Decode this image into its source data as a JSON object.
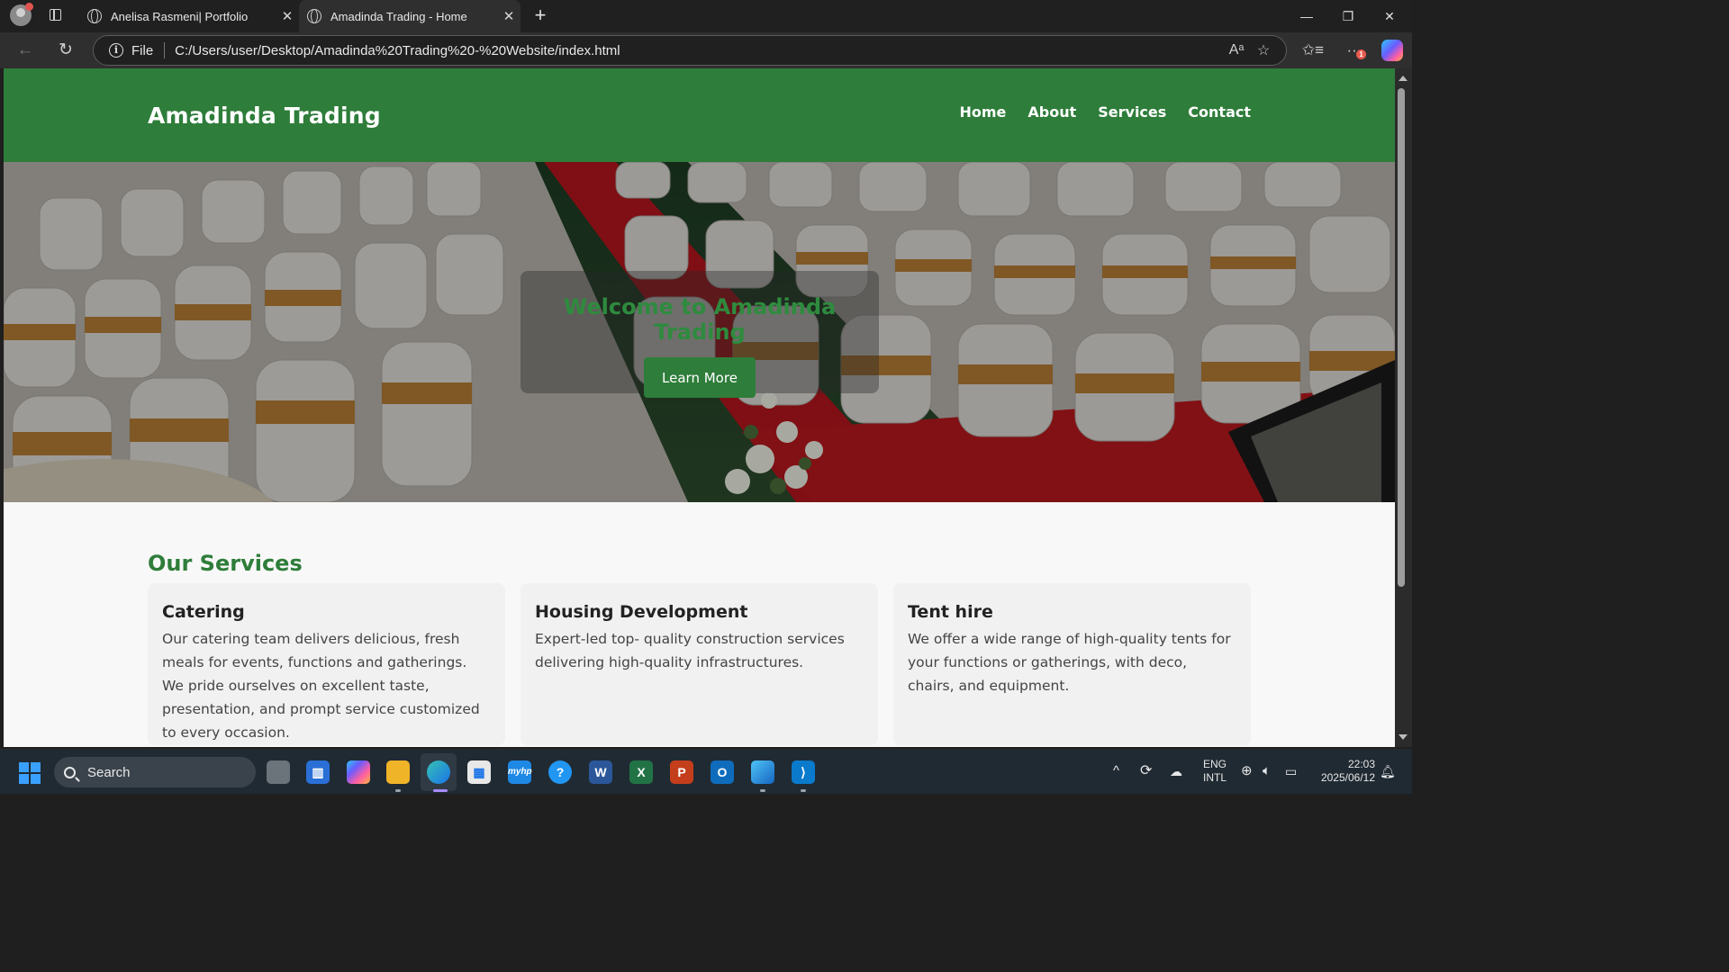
{
  "browser": {
    "tabs": [
      {
        "title": "Anelisa Rasmeni| Portfolio",
        "active": false
      },
      {
        "title": "Amadinda Trading - Home",
        "active": true
      }
    ],
    "address_scheme": "File",
    "address_url": "C:/Users/user/Desktop/Amadinda%20Trading%20-%20Website/index.html",
    "icons": [
      "profile-icon",
      "tab-actions-icon",
      "globe-icon",
      "close-icon",
      "new-tab-icon",
      "minimize-icon",
      "restore-icon",
      "window-close-icon",
      "back-icon",
      "refresh-icon",
      "info-icon",
      "read-aloud-icon",
      "favorite-star-icon",
      "favorites-icon",
      "more-icon",
      "copilot-icon"
    ],
    "notification_badge": "1"
  },
  "site": {
    "brand": "Amadinda Trading",
    "nav": [
      "Home",
      "About",
      "Services",
      "Contact"
    ],
    "hero": {
      "title": "Welcome to Amadinda Trading",
      "button": "Learn More"
    },
    "services": {
      "heading": "Our Services",
      "cards": [
        {
          "title": "Catering",
          "text": "Our catering team delivers delicious, fresh meals for events, functions and gatherings. We pride ourselves on excellent taste, presentation, and prompt service customized to every occasion."
        },
        {
          "title": "Housing Development",
          "text": "Expert-led top- quality construction services delivering high-quality infrastructures."
        },
        {
          "title": "Tent hire",
          "text": "We offer a wide range of high-quality tents for your functions or gatherings, with deco, chairs, and equipment."
        }
      ]
    },
    "colors": {
      "header": "#2e7d3a",
      "accent": "#2e8b3e",
      "card_bg": "#f1f1f1"
    }
  },
  "taskbar": {
    "search_label": "Search",
    "apps": [
      "task-view",
      "widgets",
      "copilot",
      "file-explorer",
      "edge",
      "microsoft-store",
      "hp-app",
      "get-help",
      "word",
      "excel",
      "powerpoint",
      "outlook",
      "photos",
      "vscode"
    ],
    "language_top": "ENG",
    "language_bottom": "INTL",
    "time": "22:03",
    "date": "2025/06/12"
  }
}
